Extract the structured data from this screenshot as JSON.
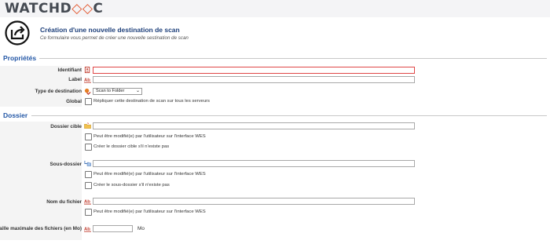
{
  "brand": {
    "logo_text_1": "WATCHD",
    "logo_mark": "◇◇",
    "logo_text_2": "C"
  },
  "header": {
    "title": "Création d'une nouvelle destination de scan",
    "subtitle": "Ce formulaire vous permet de créer une nouvelle sestination de scan"
  },
  "sections": {
    "properties": "Propriétés",
    "folder": "Dossier"
  },
  "fields": {
    "identifier": {
      "label": "Identifiant",
      "value": ""
    },
    "label": {
      "label": "Label",
      "value": ""
    },
    "dest_type": {
      "label": "Type de destination",
      "value": "Scan to Folder"
    },
    "global": {
      "label": "Global",
      "checkbox_text": "Répliquer cette destination de scan sur tous les serveurs"
    },
    "target_folder": {
      "label": "Dossier cible",
      "value": "",
      "opt1": "Peut être modifié(e) par l'utilisateur sur l'interface WES",
      "opt2": "Créer le dossier cible s'il n'existe pas"
    },
    "subfolder": {
      "label": "Sous-dossier",
      "value": "",
      "opt1": "Peut être modifié(e) par l'utilisateur sur l'interface WES",
      "opt2": "Créer le sous-dossier s'il n'existe pas"
    },
    "filename": {
      "label": "Nom du fichier",
      "value": "",
      "opt1": "Peut être modifié(e) par l'utilisateur sur l'interface WES"
    },
    "max_size": {
      "label": "Taille maximale des fichiers (en Mo)",
      "value": "",
      "unit": "Mo"
    }
  },
  "icons": {
    "header": "export-icon",
    "identifier": "id-card-icon",
    "text": "ab-text-icon",
    "dest_type": "destination-icon",
    "folder": "folder-icon",
    "subfolder": "subfolder-icon"
  }
}
